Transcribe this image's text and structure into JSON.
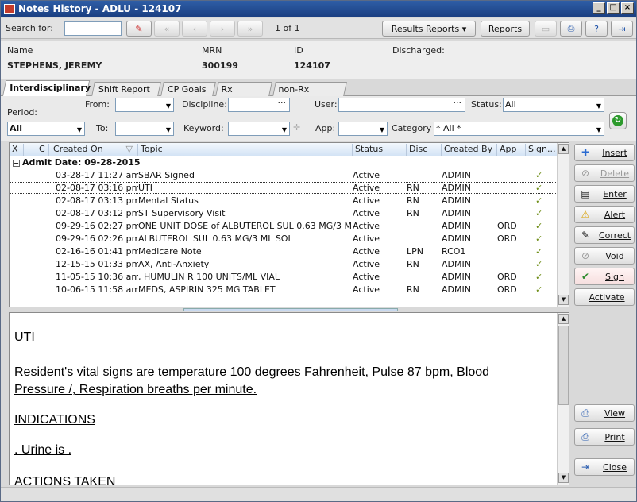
{
  "window": {
    "title": "Notes History - ADLU - 124107",
    "min": "_",
    "max": "□",
    "close": "×"
  },
  "toolbar": {
    "search_label": "Search for:",
    "search_value": "",
    "page": "1 of 1",
    "results_reports": "Results Reports",
    "reports": "Reports"
  },
  "patient": {
    "name_label": "Name",
    "name": "STEPHENS, JEREMY",
    "mrn_label": "MRN",
    "mrn": "300199",
    "id_label": "ID",
    "id": "124107",
    "discharged_label": "Discharged:"
  },
  "tabs": [
    "Interdisciplinary",
    "Shift Report",
    "CP Goals",
    "Rx Orders",
    "non-Rx Orders"
  ],
  "filters": {
    "period_label": "Period:",
    "period_value": "All",
    "from_label": "From:",
    "to_label": "To:",
    "discipline_label": "Discipline:",
    "keyword_label": "Keyword:",
    "user_label": "User:",
    "app_label": "App:",
    "status_label": "Status:",
    "status_value": "All",
    "category_label": "Category",
    "category_value": "* All *"
  },
  "grid": {
    "headers": [
      "X",
      "C",
      "Created On",
      "Topic",
      "Status",
      "Disc",
      "Created By",
      "App",
      "Sign..."
    ],
    "group": "Admit Date: 09-28-2015",
    "rows": [
      {
        "created": "03-28-17 11:27 am",
        "topic": "SBAR Signed",
        "status": "Active",
        "disc": "",
        "by": "ADMIN",
        "app": "",
        "sign": "✓"
      },
      {
        "created": "02-08-17 03:16 pm",
        "topic": "UTI",
        "status": "Active",
        "disc": "RN",
        "by": "ADMIN",
        "app": "",
        "sign": "✓"
      },
      {
        "created": "02-08-17 03:13 pm",
        "topic": "Mental Status",
        "status": "Active",
        "disc": "RN",
        "by": "ADMIN",
        "app": "",
        "sign": "✓"
      },
      {
        "created": "02-08-17 03:12 pm",
        "topic": "ST Supervisory Visit",
        "status": "Active",
        "disc": "RN",
        "by": "ADMIN",
        "app": "",
        "sign": "✓"
      },
      {
        "created": "09-29-16 02:27 pm",
        "topic": "ONE UNIT DOSE of ALBUTEROL SUL 0.63 MG/3 M",
        "status": "Active",
        "disc": "",
        "by": "ADMIN",
        "app": "ORD",
        "sign": "✓"
      },
      {
        "created": "09-29-16 02:26 pm",
        "topic": "ALBUTEROL SUL 0.63 MG/3 ML SOL",
        "status": "Active",
        "disc": "",
        "by": "ADMIN",
        "app": "ORD",
        "sign": "✓"
      },
      {
        "created": "02-16-16 01:41 pm",
        "topic": "Medicare Note",
        "status": "Active",
        "disc": "LPN",
        "by": "RCO1",
        "app": "",
        "sign": "✓"
      },
      {
        "created": "12-15-15 01:33 pm",
        "topic": "AX, Anti-Anxiety",
        "status": "Active",
        "disc": "RN",
        "by": "ADMIN",
        "app": "",
        "sign": "✓"
      },
      {
        "created": "11-05-15 10:36 am",
        "topic": ", HUMULIN R 100 UNITS/ML VIAL",
        "status": "Active",
        "disc": "",
        "by": "ADMIN",
        "app": "ORD",
        "sign": "✓"
      },
      {
        "created": "10-06-15 11:58 am",
        "topic": "MEDS, ASPIRIN 325 MG TABLET",
        "status": "Active",
        "disc": "RN",
        "by": "ADMIN",
        "app": "ORD",
        "sign": "✓"
      }
    ]
  },
  "note": {
    "title": "UTI",
    "p1": "Resident's vital signs are temperature 100 degrees Fahrenheit, Pulse 87 bpm, Blood",
    "p2": "Pressure /,  Respiration  breaths per minute.",
    "h2": "INDICATIONS",
    "p3": ". Urine is .",
    "h3": "ACTIONS TAKEN"
  },
  "side": {
    "insert": "Insert",
    "delete": "Delete",
    "enter": "Enter",
    "alert": "Alert",
    "correct": "Correct",
    "void": "Void",
    "sign": "Sign",
    "activate": "Activate",
    "view": "View",
    "print": "Print",
    "close": "Close"
  }
}
